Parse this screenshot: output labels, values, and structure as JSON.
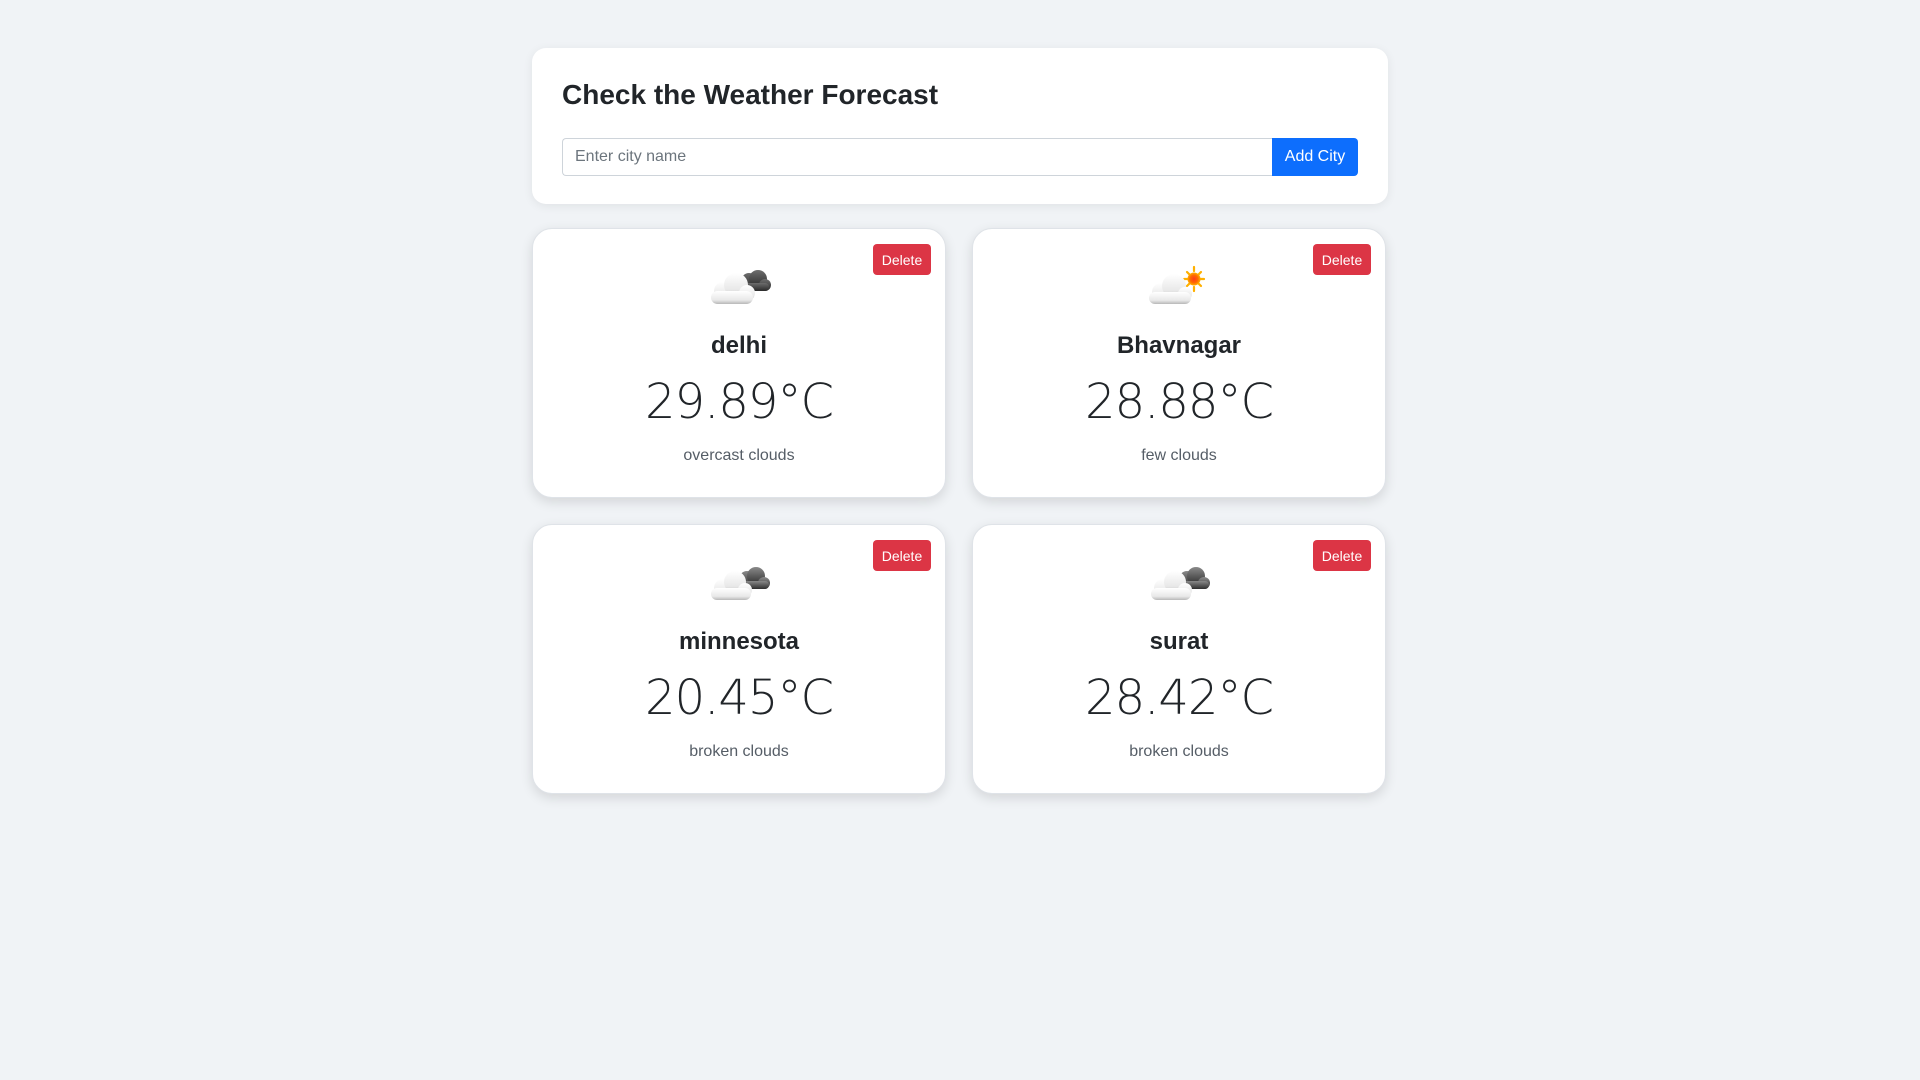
{
  "header": {
    "title": "Check the Weather Forecast",
    "input_placeholder": "Enter city name",
    "input_value": "",
    "add_button_label": "Add City"
  },
  "cities": [
    {
      "name": "delhi",
      "temperature": "29.89°C",
      "description": "overcast clouds",
      "icon": "overcast-clouds-icon",
      "delete_label": "Delete"
    },
    {
      "name": "Bhavnagar",
      "temperature": "28.88°C",
      "description": "few clouds",
      "icon": "few-clouds-sun-icon",
      "delete_label": "Delete"
    },
    {
      "name": "minnesota",
      "temperature": "20.45°C",
      "description": "broken clouds",
      "icon": "broken-clouds-icon",
      "delete_label": "Delete"
    },
    {
      "name": "surat",
      "temperature": "28.42°C",
      "description": "broken clouds",
      "icon": "broken-clouds-icon",
      "delete_label": "Delete"
    }
  ],
  "colors": {
    "background": "#f0f3f6",
    "primary": "#0d6efd",
    "danger": "#dc3545",
    "card": "#ffffff"
  }
}
